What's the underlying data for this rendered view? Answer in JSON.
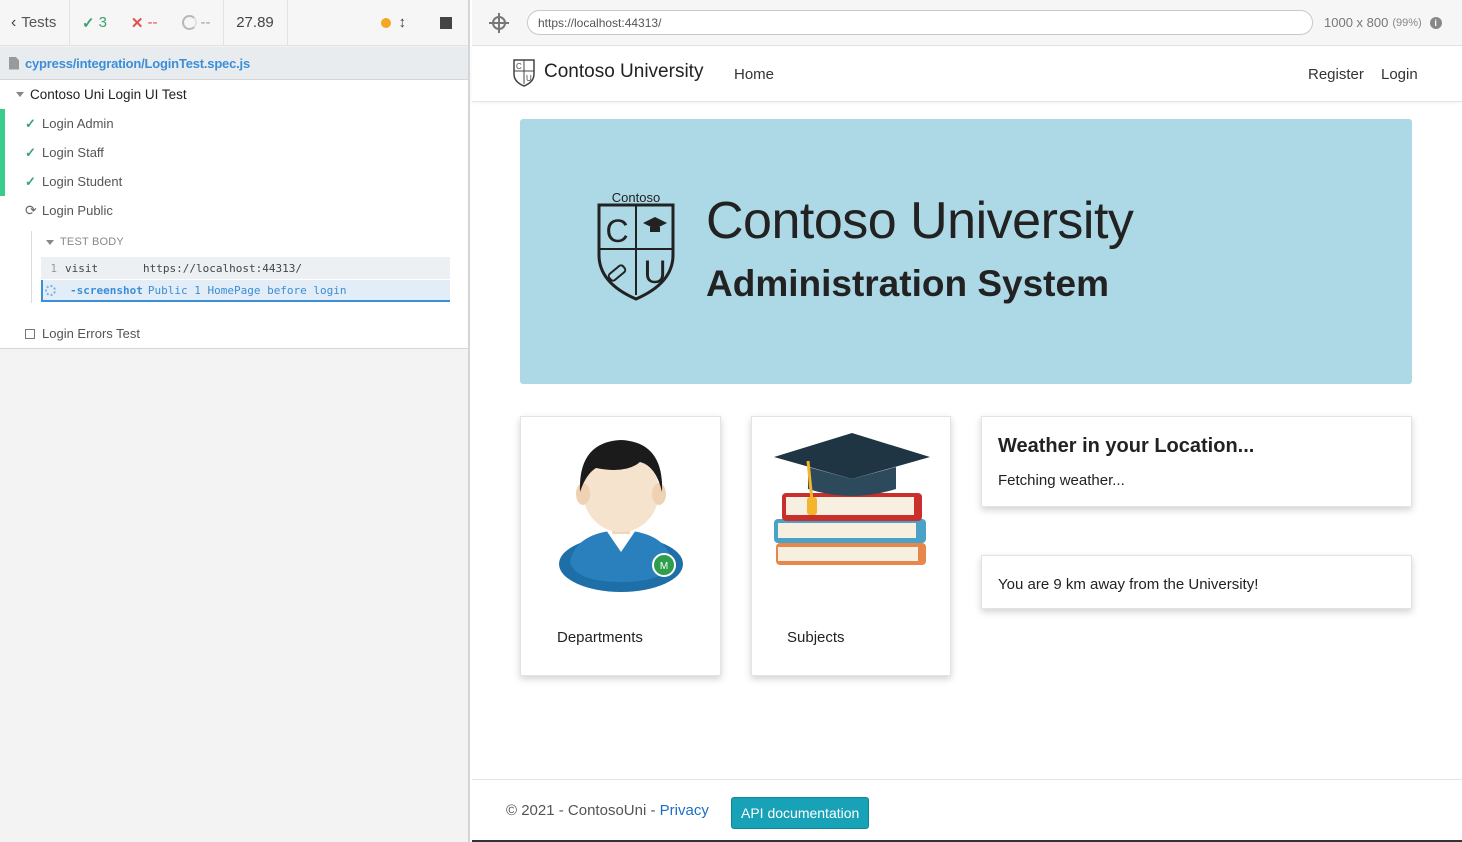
{
  "reporter": {
    "tests_label": "Tests",
    "passed_count": "3",
    "failed_count": "--",
    "pending_count": "--",
    "duration": "27.89",
    "spec_path": "cypress/integration/LoginTest.spec.js",
    "suite_title": "Contoso Uni Login UI Test",
    "tests": [
      {
        "label": "Login Admin",
        "state": "passed"
      },
      {
        "label": "Login Staff",
        "state": "passed"
      },
      {
        "label": "Login Student",
        "state": "passed"
      },
      {
        "label": "Login Public",
        "state": "running"
      },
      {
        "label": "Login Errors Test",
        "state": "pending"
      }
    ],
    "test_body_label": "TEST BODY",
    "commands": [
      {
        "number": "1",
        "name": "visit",
        "message": "https://localhost:44313/"
      },
      {
        "number": "",
        "name": "-screenshot",
        "message": "Public 1 HomePage before login"
      }
    ]
  },
  "browser": {
    "url": "https://localhost:44313/",
    "viewport": "1000 x 800",
    "scale": "(99%)"
  },
  "app": {
    "brand": "Contoso University",
    "nav_home": "Home",
    "nav_register": "Register",
    "nav_login": "Login",
    "logo_word": "Contoso",
    "logo_letters": [
      "C",
      "U"
    ],
    "jumbo_title": "Contoso University",
    "jumbo_subtitle": "Administration System",
    "cards": [
      {
        "label": "Departments",
        "icon": "user-avatar-icon"
      },
      {
        "label": "Subjects",
        "icon": "books-graduation-cap-icon"
      }
    ],
    "weather_title": "Weather in your Location...",
    "weather_status": "Fetching weather...",
    "distance_text": "You are 9 km away from the University!",
    "footer_text": "© 2021 - ContosoUni - ",
    "footer_privacy": "Privacy",
    "api_button": "API documentation"
  },
  "colors": {
    "passed": "#3aa372",
    "failed": "#e45050",
    "jumbotron": "#add8e6",
    "api_button": "#17a2b8",
    "link": "#1b6ec2"
  }
}
